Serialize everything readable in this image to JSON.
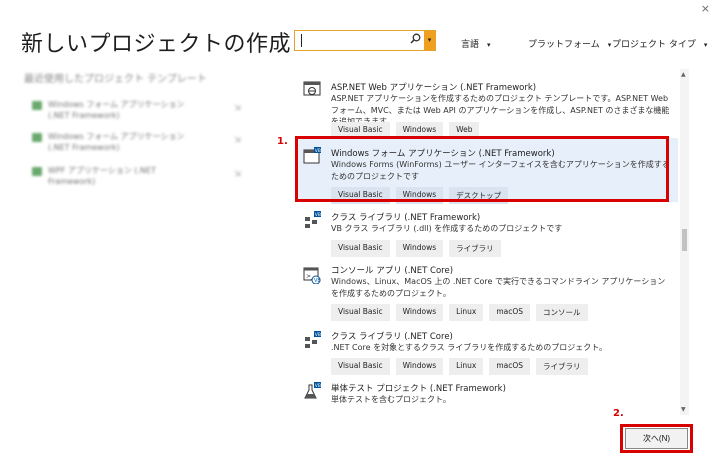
{
  "window": {
    "close_glyph": "×"
  },
  "title": "新しいプロジェクトの作成",
  "recent": {
    "heading": "最近使用したプロジェクト テンプレート",
    "items": [
      {
        "label": "Windows フォーム アプリケーション (.NET Framework)",
        "arrow": "⇲"
      },
      {
        "label": "Windows フォーム アプリケーション (.NET Framework)",
        "arrow": "⇲"
      },
      {
        "label": "WPF アプリケーション (.NET Framework)",
        "arrow": "⇲"
      }
    ]
  },
  "search": {
    "placeholder": "",
    "icon": "search-icon",
    "dropdown_glyph": "▾"
  },
  "filters": {
    "language": "言語",
    "platform": "プラットフォーム",
    "project_type": "プロジェクト タイプ",
    "caret": "▾"
  },
  "templates": [
    {
      "name": "ASP.NET Web アプリケーション (.NET Framework)",
      "desc": "ASP.NET アプリケーションを作成するためのプロジェクト テンプレートです。ASP.NET Web フォーム、MVC、または Web API のアプリケーションを作成し、ASP.NET のさまざまな機能を追加できます。",
      "tags": [
        "Visual Basic",
        "Windows",
        "Web"
      ]
    },
    {
      "name": "Windows フォーム アプリケーション (.NET Framework)",
      "desc": "Windows Forms (WinForms) ユーザー インターフェイスを含むアプリケーションを作成するためのプロジェクトです",
      "tags": [
        "Visual Basic",
        "Windows",
        "デスクトップ"
      ]
    },
    {
      "name": "クラス ライブラリ (.NET Framework)",
      "desc": "VB クラス ライブラリ (.dll) を作成するためのプロジェクトです",
      "tags": [
        "Visual Basic",
        "Windows",
        "ライブラリ"
      ]
    },
    {
      "name": "コンソール アプリ (.NET Core)",
      "desc": "Windows、Linux、MacOS 上の .NET Core で実行できるコマンドライン アプリケーションを作成するためのプロジェクト。",
      "tags": [
        "Visual Basic",
        "Windows",
        "Linux",
        "macOS",
        "コンソール"
      ]
    },
    {
      "name": "クラス ライブラリ (.NET Core)",
      "desc": ".NET Core を対象とするクラス ライブラリを作成するためのプロジェクト。",
      "tags": [
        "Visual Basic",
        "Windows",
        "Linux",
        "macOS",
        "ライブラリ"
      ]
    },
    {
      "name": "単体テスト プロジェクト (.NET Framework)",
      "desc": "単体テストを含むプロジェクト。",
      "tags": []
    }
  ],
  "annotations": {
    "step1": "1.",
    "step2": "2."
  },
  "footer": {
    "next_label": "次へ(N)"
  },
  "colors": {
    "highlight": "#d90000",
    "selected_bg": "#e7f0fa",
    "search_accent": "#f0a020"
  }
}
